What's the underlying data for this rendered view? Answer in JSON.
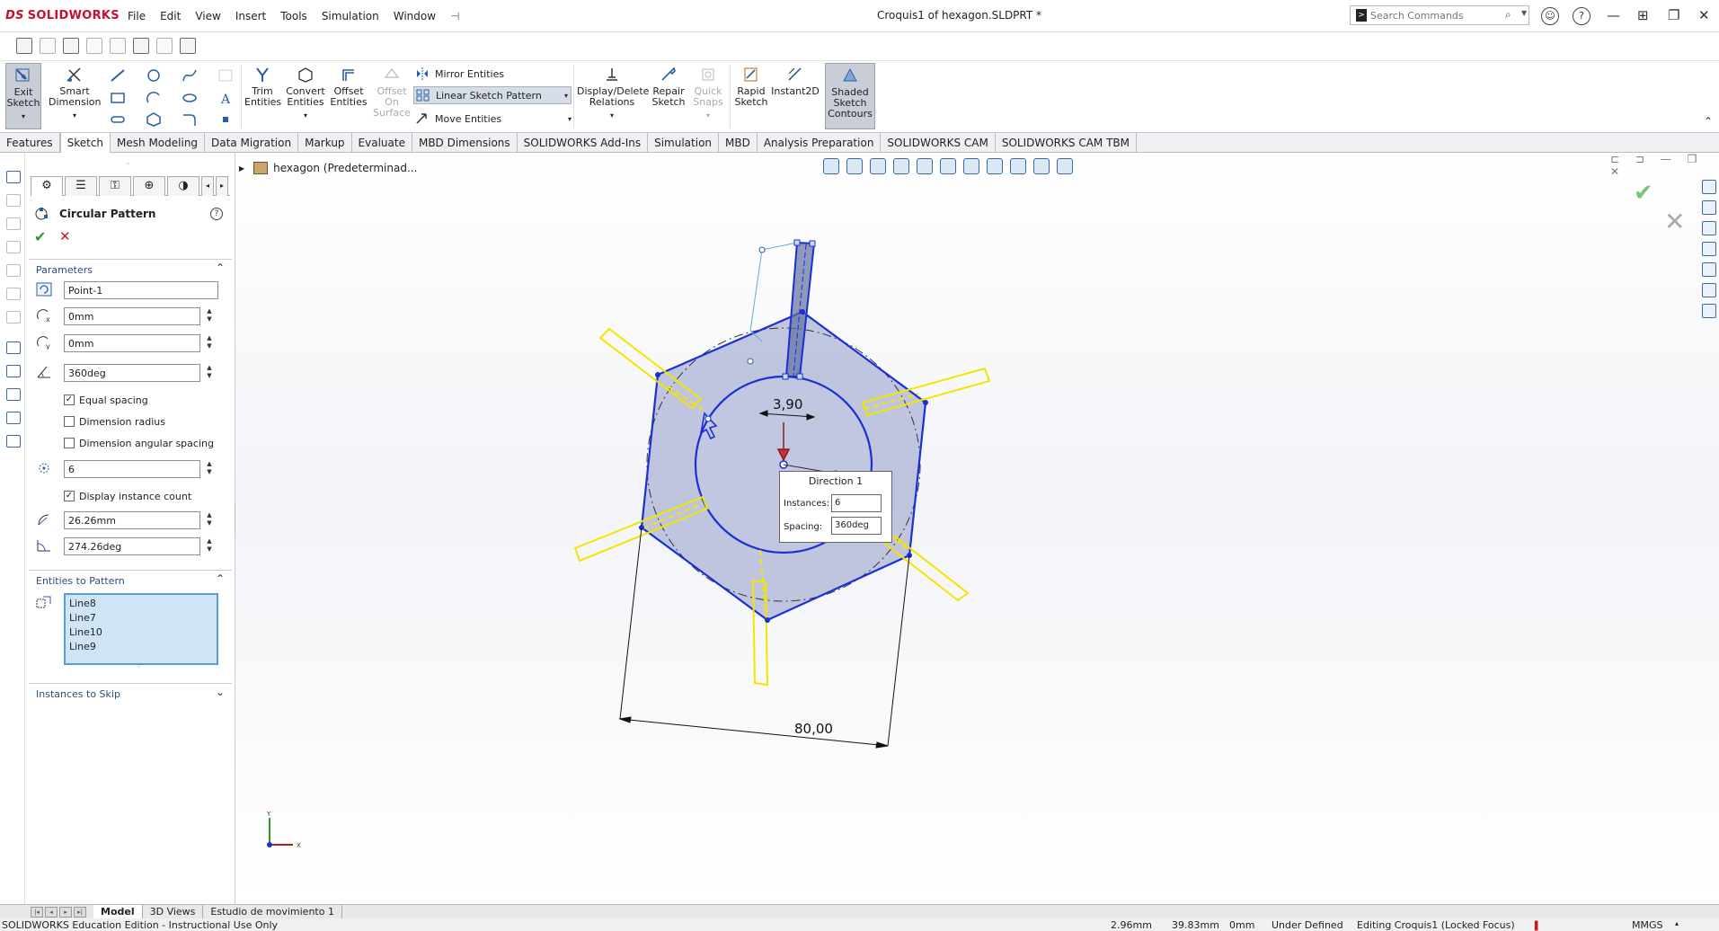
{
  "app": {
    "brand": "SOLIDWORKS",
    "menu": [
      "File",
      "Edit",
      "View",
      "Insert",
      "Tools",
      "Simulation",
      "Window"
    ],
    "document_title": "Croquis1 of hexagon.SLDPRT *",
    "search_placeholder": "Search Commands"
  },
  "ribbon": {
    "exit_sketch": [
      "Exit",
      "Sketch"
    ],
    "smart_dimension": [
      "Smart",
      "Dimension"
    ],
    "trim_entities": [
      "Trim",
      "Entities"
    ],
    "convert_entities": [
      "Convert",
      "Entities"
    ],
    "offset_entities": [
      "Offset",
      "Entities"
    ],
    "offset_on_surface": [
      "Offset",
      "On",
      "Surface"
    ],
    "mirror_entities": "Mirror Entities",
    "linear_sketch_pattern": "Linear Sketch Pattern",
    "move_entities": "Move Entities",
    "display_delete_relations": [
      "Display/Delete",
      "Relations"
    ],
    "repair_sketch": [
      "Repair",
      "Sketch"
    ],
    "quick_snaps": [
      "Quick",
      "Snaps"
    ],
    "rapid_sketch": [
      "Rapid",
      "Sketch"
    ],
    "instant2d": "Instant2D",
    "shaded_sketch_contours": [
      "Shaded",
      "Sketch",
      "Contours"
    ]
  },
  "tabs": [
    "Features",
    "Sketch",
    "Mesh Modeling",
    "Data Migration",
    "Markup",
    "Evaluate",
    "MBD Dimensions",
    "SOLIDWORKS Add-Ins",
    "Simulation",
    "MBD",
    "Analysis Preparation",
    "SOLIDWORKS CAM",
    "SOLIDWORKS CAM TBM"
  ],
  "active_tab": "Sketch",
  "property_manager": {
    "title": "Circular Pattern",
    "parameters_label": "Parameters",
    "center_point": "Point-1",
    "center_x": "0mm",
    "center_y": "0mm",
    "angle": "360deg",
    "equal_spacing_label": "Equal spacing",
    "equal_spacing_checked": true,
    "dimension_radius_label": "Dimension radius",
    "dimension_radius_checked": false,
    "dimension_angular_spacing_label": "Dimension angular spacing",
    "dimension_angular_spacing_checked": false,
    "instances": "6",
    "display_instance_count_label": "Display instance count",
    "display_instance_count_checked": true,
    "radius": "26.26mm",
    "arc_angle": "274.26deg",
    "entities_to_pattern_label": "Entities to Pattern",
    "entities": [
      "Line8",
      "Line7",
      "Line10",
      "Line9"
    ],
    "instances_to_skip_label": "Instances to Skip"
  },
  "graphics": {
    "tree_flyout": "hexagon (Predeterminad...",
    "direction_box": {
      "title": "Direction 1",
      "instances_label": "Instances:",
      "instances_value": "6",
      "spacing_label": "Spacing:",
      "spacing_value": "360deg"
    },
    "dim_width": "80,00",
    "dim_slot": "3,90",
    "triad_y": "Y",
    "triad_x": "X"
  },
  "bottom_tabs": [
    "Model",
    "3D Views",
    "Estudio de movimiento 1"
  ],
  "active_bottom_tab": "Model",
  "status": {
    "edition": "SOLIDWORKS Education Edition - Instructional Use Only",
    "x": "2.96mm",
    "y": "39.83mm",
    "z": "0mm",
    "state": "Under Defined",
    "editing": "Editing Croquis1 (Locked Focus)",
    "units": "MMGS"
  },
  "colors": {
    "brand_red": "#c8102e",
    "sketch_blue": "#1a2fd6",
    "preview_yellow": "#f2e600",
    "selection_blue": "#cfe4f6",
    "ok_green": "#2a9d2a",
    "cancel_red": "#c21d1d"
  }
}
